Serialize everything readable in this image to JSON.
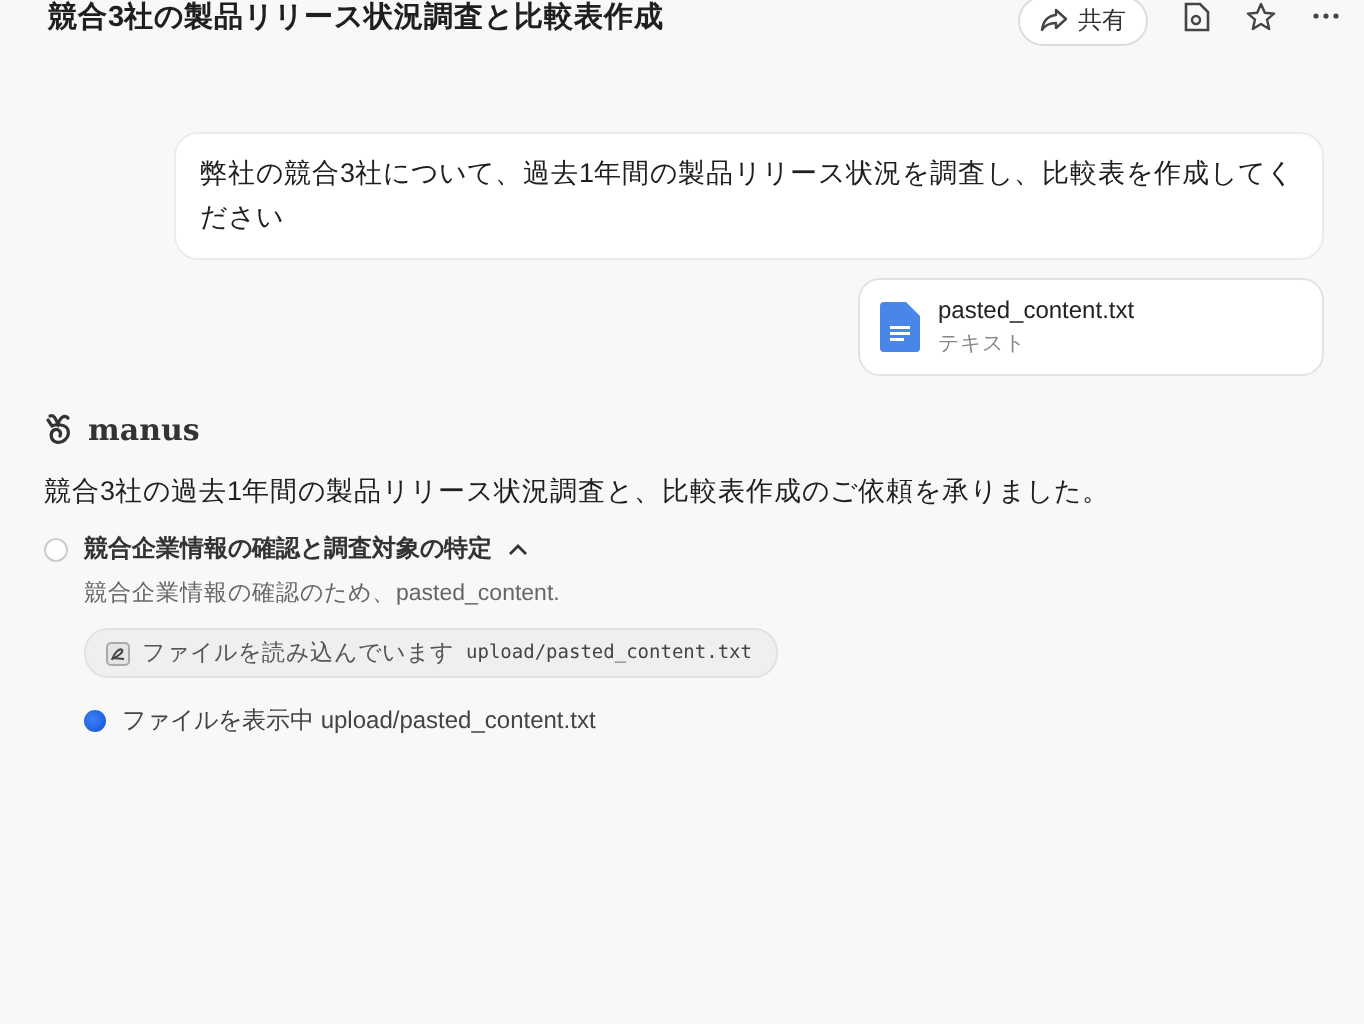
{
  "header": {
    "title": "競合3社の製品リリース状況調査と比較表作成",
    "share_label": "共有"
  },
  "user_message": {
    "text": "弊社の競合3社について、過去1年間の製品リリース状況を調査し、比較表を作成してください",
    "attachment": {
      "name": "pasted_content.txt",
      "type": "テキスト"
    }
  },
  "assistant": {
    "name": "manus",
    "reply": "競合3社の過去1年間の製品リリース状況調査と、比較表作成のご依頼を承りました。",
    "steps": [
      {
        "title": "競合企業情報の確認と調査対象の特定",
        "done": false,
        "expanded": true,
        "description": "競合企業情報の確認のため、pasted_content.",
        "tool": {
          "action": "ファイルを読み込んでいます",
          "path": "upload/pasted_content.txt"
        },
        "status": "ファイルを表示中 upload/pasted_content.txt"
      }
    ]
  }
}
